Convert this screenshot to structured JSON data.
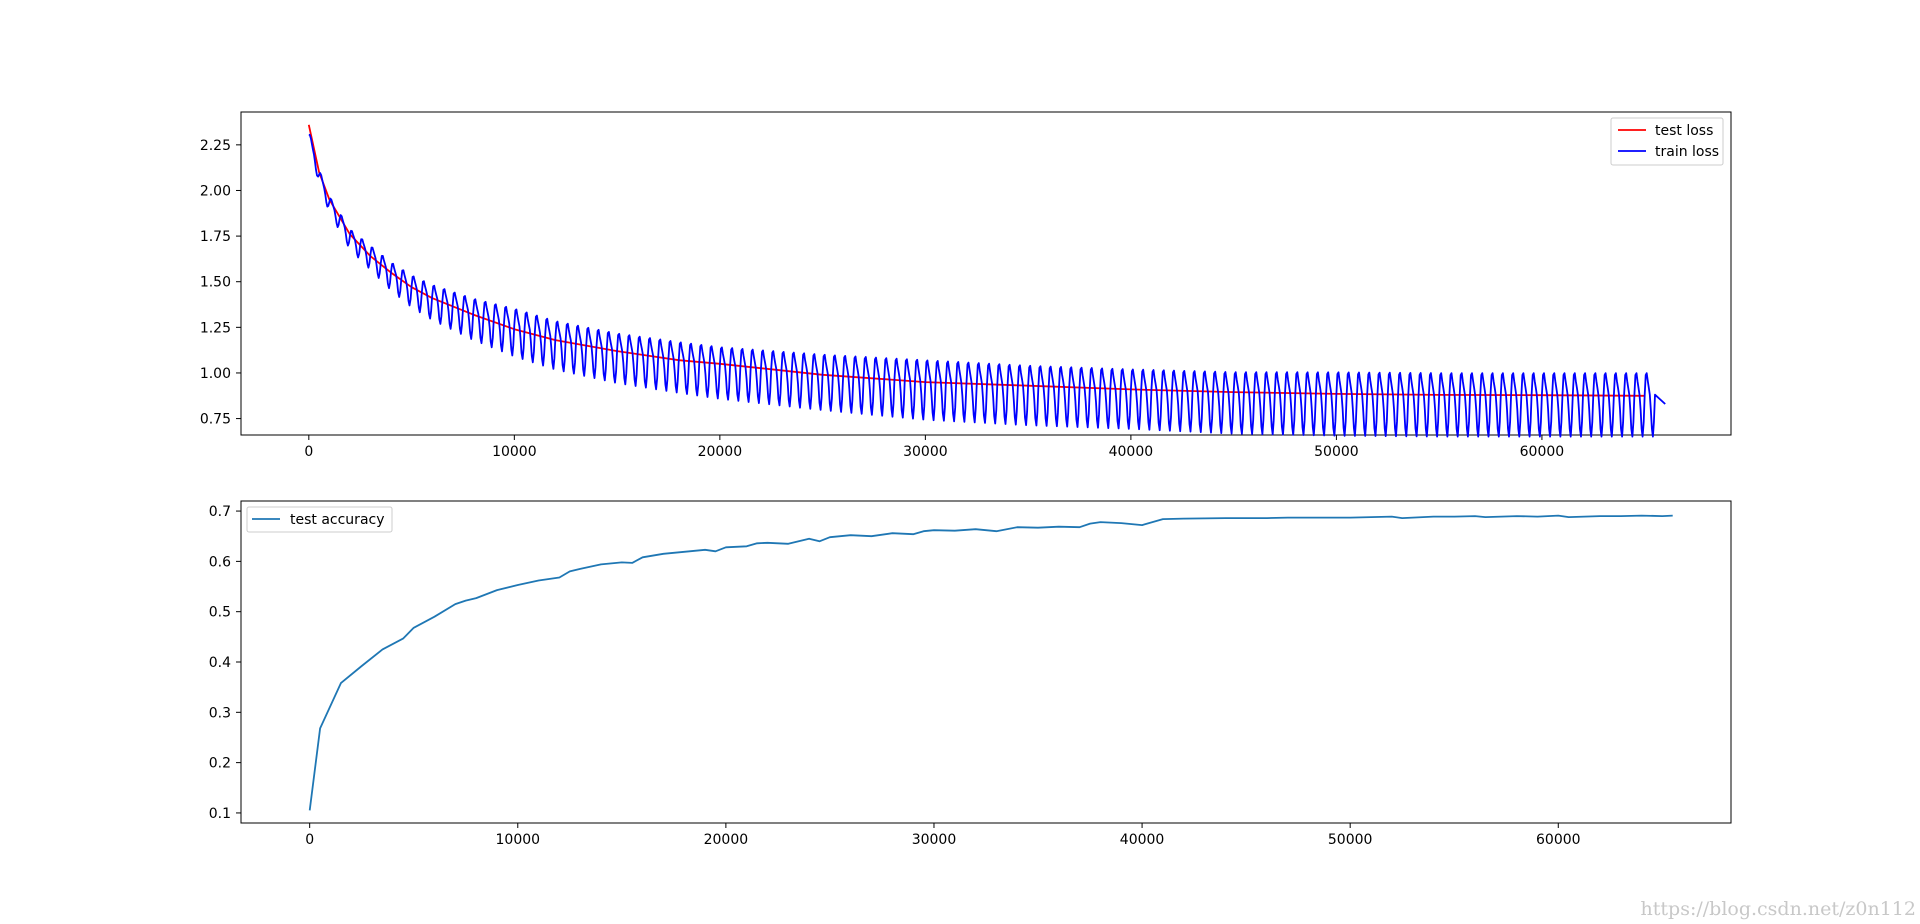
{
  "chart_data": [
    {
      "type": "line",
      "xlim": [
        -3300,
        69200
      ],
      "ylim": [
        0.66,
        2.43
      ],
      "xticks": [
        0,
        10000,
        20000,
        30000,
        40000,
        50000,
        60000
      ],
      "xtick_labels": [
        "0",
        "10000",
        "20000",
        "30000",
        "40000",
        "50000",
        "60000"
      ],
      "yticks": [
        0.75,
        1.0,
        1.25,
        1.5,
        1.75,
        2.0,
        2.25
      ],
      "ytick_labels": [
        "0.75",
        "1.00",
        "1.25",
        "1.50",
        "1.75",
        "2.00",
        "2.25"
      ],
      "grid": false,
      "legend": "upper-right",
      "series": [
        {
          "name": "test loss",
          "color": "#ff0000",
          "x": [
            0,
            500,
            1000,
            2000,
            3000,
            4000,
            5000,
            6000,
            8000,
            10000,
            12000,
            15000,
            18000,
            20000,
            25000,
            30000,
            35000,
            40000,
            45000,
            50000,
            55000,
            60000,
            65000
          ],
          "y": [
            2.36,
            2.1,
            1.95,
            1.76,
            1.64,
            1.55,
            1.47,
            1.41,
            1.32,
            1.24,
            1.18,
            1.12,
            1.07,
            1.05,
            0.99,
            0.95,
            0.93,
            0.91,
            0.895,
            0.885,
            0.88,
            0.878,
            0.875
          ]
        },
        {
          "name": "train loss",
          "color": "#0000ff",
          "trend": {
            "x": [
              0,
              500,
              1000,
              2000,
              3000,
              4000,
              5000,
              6000,
              8000,
              10000,
              12000,
              15000,
              18000,
              20000,
              25000,
              30000,
              35000,
              40000,
              45000,
              50000,
              55000,
              60000,
              65000
            ],
            "y": [
              2.3,
              2.08,
              1.93,
              1.74,
              1.64,
              1.54,
              1.46,
              1.4,
              1.31,
              1.24,
              1.17,
              1.1,
              1.05,
              1.02,
              0.97,
              0.93,
              0.9,
              0.88,
              0.86,
              0.855,
              0.85,
              0.85,
              0.85
            ]
          },
          "oscillation_period": 500,
          "oscillation_amplitude": {
            "x": [
              0,
              5000,
              10000,
              20000,
              30000,
              40000,
              50000,
              65000
            ],
            "y": [
              0.03,
              0.08,
              0.12,
              0.13,
              0.15,
              0.15,
              0.16,
              0.16
            ]
          },
          "x_end": 66000,
          "y_end": 0.83
        }
      ]
    },
    {
      "type": "line",
      "xlim": [
        -3300,
        68300
      ],
      "ylim": [
        0.08,
        0.72
      ],
      "xticks": [
        0,
        10000,
        20000,
        30000,
        40000,
        50000,
        60000
      ],
      "xtick_labels": [
        "0",
        "10000",
        "20000",
        "30000",
        "40000",
        "50000",
        "60000"
      ],
      "yticks": [
        0.1,
        0.2,
        0.3,
        0.4,
        0.5,
        0.6,
        0.7
      ],
      "ytick_labels": [
        "0.1",
        "0.2",
        "0.3",
        "0.4",
        "0.5",
        "0.6",
        "0.7"
      ],
      "grid": false,
      "legend": "upper-left",
      "series": [
        {
          "name": "test accuracy",
          "color": "#1f77b4",
          "x": [
            0,
            500,
            1500,
            2500,
            3500,
            4500,
            5000,
            6000,
            7000,
            7500,
            8000,
            9000,
            10000,
            11000,
            12000,
            12500,
            13000,
            14000,
            15000,
            15500,
            16000,
            17000,
            18000,
            19000,
            19500,
            20000,
            21000,
            21500,
            22000,
            23000,
            24000,
            24500,
            25000,
            26000,
            27000,
            28000,
            29000,
            29500,
            30000,
            31000,
            32000,
            33000,
            34000,
            35000,
            36000,
            37000,
            37500,
            38000,
            39000,
            40000,
            41000,
            42000,
            44000,
            46000,
            47000,
            48000,
            50000,
            51000,
            52000,
            52500,
            54000,
            55000,
            56000,
            56500,
            58000,
            59000,
            60000,
            60500,
            62000,
            63000,
            64000,
            65000,
            65500
          ],
          "y": [
            0.105,
            0.268,
            0.358,
            0.392,
            0.425,
            0.447,
            0.468,
            0.49,
            0.515,
            0.522,
            0.527,
            0.543,
            0.553,
            0.562,
            0.568,
            0.58,
            0.585,
            0.594,
            0.598,
            0.597,
            0.608,
            0.615,
            0.619,
            0.623,
            0.62,
            0.628,
            0.63,
            0.636,
            0.637,
            0.635,
            0.645,
            0.64,
            0.648,
            0.652,
            0.65,
            0.656,
            0.654,
            0.66,
            0.662,
            0.661,
            0.664,
            0.66,
            0.668,
            0.667,
            0.669,
            0.668,
            0.675,
            0.678,
            0.676,
            0.672,
            0.684,
            0.685,
            0.686,
            0.686,
            0.687,
            0.687,
            0.687,
            0.688,
            0.689,
            0.686,
            0.689,
            0.689,
            0.69,
            0.688,
            0.69,
            0.689,
            0.691,
            0.688,
            0.69,
            0.69,
            0.691,
            0.69,
            0.691
          ]
        }
      ]
    }
  ],
  "watermark": "https://blog.csdn.net/z0n112"
}
